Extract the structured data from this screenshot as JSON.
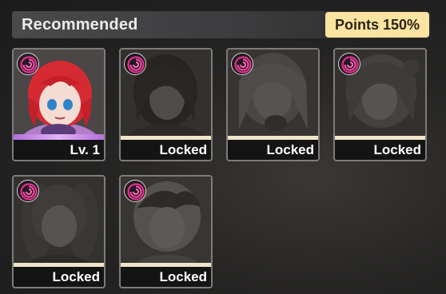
{
  "header": {
    "title": "Recommended",
    "points_label": "Points 150%"
  },
  "colors": {
    "accent_points": "#fbe3a1",
    "element_pink": "#e0338e",
    "active_bar": "#c98ce8",
    "locked_bar": "#efe6c9"
  },
  "cards": [
    {
      "status": "Lv. 1",
      "locked": false,
      "element_icon": "pink-swirl-icon"
    },
    {
      "status": "Locked",
      "locked": true,
      "element_icon": "pink-swirl-icon"
    },
    {
      "status": "Locked",
      "locked": true,
      "element_icon": "pink-swirl-icon"
    },
    {
      "status": "Locked",
      "locked": true,
      "element_icon": "pink-swirl-icon"
    },
    {
      "status": "Locked",
      "locked": true,
      "element_icon": "pink-swirl-icon"
    },
    {
      "status": "Locked",
      "locked": true,
      "element_icon": "pink-swirl-icon"
    }
  ]
}
